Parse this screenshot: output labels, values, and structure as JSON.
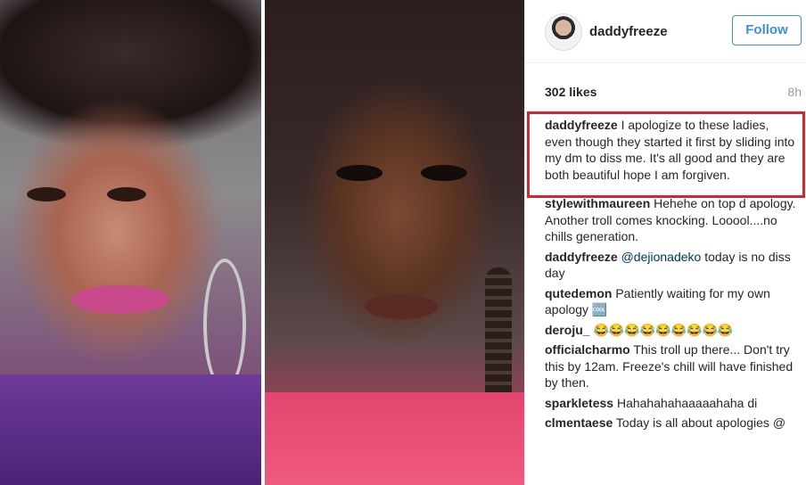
{
  "post": {
    "username": "daddyfreeze",
    "follow_label": "Follow",
    "likes": "302 likes",
    "time": "8h",
    "caption": {
      "user": "daddyfreeze",
      "text": "I apologize to these ladies, even though they started it first by sliding into my dm to diss me. It's all good and they are both beautiful hope I am forgiven."
    },
    "comments": [
      {
        "user": "stylewithmaureen",
        "text": "Hehehe on top d apology. Another troll comes knocking. Looool....no chills generation."
      },
      {
        "user": "daddyfreeze",
        "mention": "@dejionadeko",
        "text": "today is no diss day"
      },
      {
        "user": "qutedemon",
        "text": "Patiently waiting for my own apology 🆒"
      },
      {
        "user": "deroju_",
        "text": "😂😂😂😂😂😂😂😂😂"
      },
      {
        "user": "officialcharmo",
        "text": "This troll up there... Don't try this by 12am. Freeze's chill will have finished by then."
      },
      {
        "user": "sparkletess",
        "text": "Hahahahahaaaaahaha di"
      },
      {
        "user": "clmentaese",
        "text": "Today is all about apologies @"
      }
    ]
  },
  "colors": {
    "accent": "#3b8fd9",
    "highlight_box": "#d6262e"
  }
}
